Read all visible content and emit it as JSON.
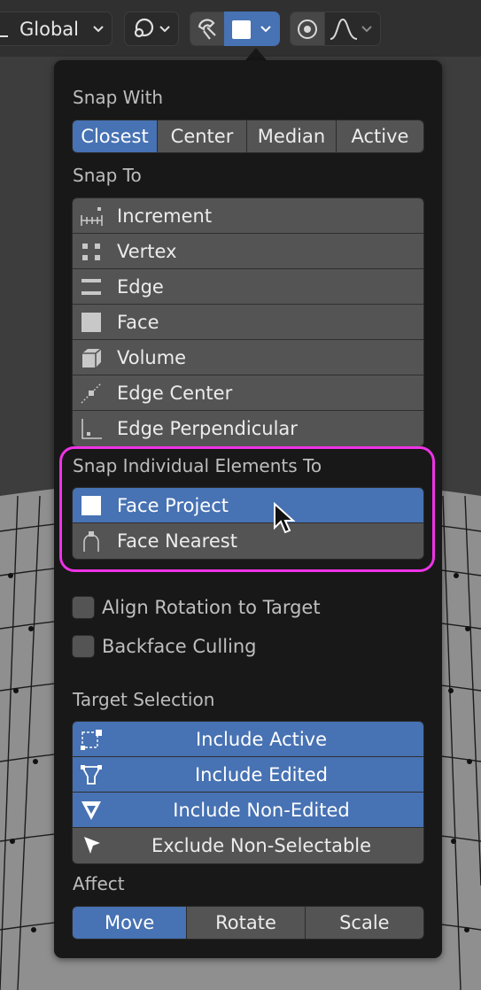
{
  "header": {
    "orientation_label": "Global"
  },
  "popup": {
    "snap_with": {
      "label": "Snap With",
      "options": [
        "Closest",
        "Center",
        "Median",
        "Active"
      ],
      "selected": "Closest"
    },
    "snap_to": {
      "label": "Snap To",
      "items": [
        {
          "label": "Increment",
          "icon": "increment-icon"
        },
        {
          "label": "Vertex",
          "icon": "vertex-icon"
        },
        {
          "label": "Edge",
          "icon": "edge-icon"
        },
        {
          "label": "Face",
          "icon": "face-icon"
        },
        {
          "label": "Volume",
          "icon": "volume-icon"
        },
        {
          "label": "Edge Center",
          "icon": "edge-center-icon"
        },
        {
          "label": "Edge Perpendicular",
          "icon": "edge-perpendicular-icon"
        }
      ]
    },
    "snap_individual": {
      "label": "Snap Individual Elements To",
      "items": [
        {
          "label": "Face Project",
          "icon": "face-project-icon",
          "selected": true
        },
        {
          "label": "Face Nearest",
          "icon": "face-nearest-icon",
          "selected": false
        }
      ]
    },
    "options": {
      "align_rotation": "Align Rotation to Target",
      "backface_culling": "Backface Culling"
    },
    "target_selection": {
      "label": "Target Selection",
      "items": [
        {
          "label": "Include Active",
          "icon": "include-active-icon",
          "selected": true
        },
        {
          "label": "Include Edited",
          "icon": "include-edited-icon",
          "selected": true
        },
        {
          "label": "Include Non-Edited",
          "icon": "include-non-edited-icon",
          "selected": true
        },
        {
          "label": "Exclude Non-Selectable",
          "icon": "exclude-non-selectable-icon",
          "selected": false
        }
      ]
    },
    "affect": {
      "label": "Affect",
      "options": [
        "Move",
        "Rotate",
        "Scale"
      ],
      "selected": "Move"
    }
  },
  "colors": {
    "accent": "#4772b3",
    "panel_bg": "#181818",
    "item_bg": "#545454",
    "highlight_ring": "#ee33e6"
  }
}
